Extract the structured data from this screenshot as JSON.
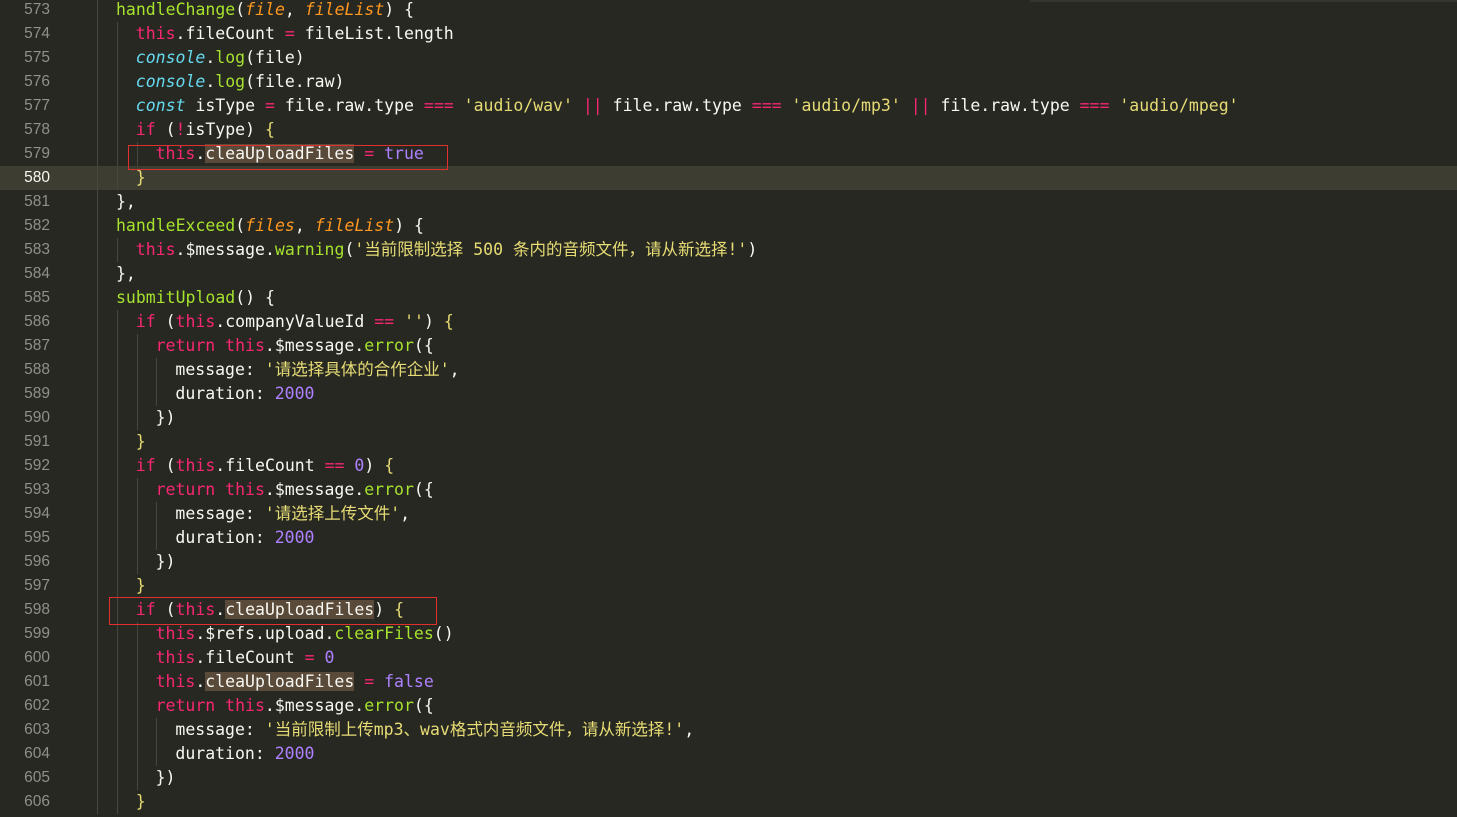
{
  "editor": {
    "active_line": 580,
    "lines": [
      {
        "n": 573,
        "indent": 0,
        "tokens": [
          [
            "fn",
            "handleChange"
          ],
          [
            "punc",
            "("
          ],
          [
            "param",
            "file"
          ],
          [
            "punc",
            ", "
          ],
          [
            "param",
            "fileList"
          ],
          [
            "punc",
            ") {"
          ]
        ]
      },
      {
        "n": 574,
        "indent": 1,
        "tokens": [
          [
            "this",
            "this"
          ],
          [
            "punc",
            "."
          ],
          [
            "prop",
            "fileCount"
          ],
          [
            "op",
            " = "
          ],
          [
            "prop",
            "fileList.length"
          ]
        ]
      },
      {
        "n": 575,
        "indent": 1,
        "tokens": [
          [
            "obj",
            "console"
          ],
          [
            "punc",
            "."
          ],
          [
            "method",
            "log"
          ],
          [
            "punc",
            "(file)"
          ]
        ]
      },
      {
        "n": 576,
        "indent": 1,
        "tokens": [
          [
            "obj",
            "console"
          ],
          [
            "punc",
            "."
          ],
          [
            "method",
            "log"
          ],
          [
            "punc",
            "(file.raw)"
          ]
        ]
      },
      {
        "n": 577,
        "indent": 1,
        "tokens": [
          [
            "decl",
            "const"
          ],
          [
            "plain",
            " isType "
          ],
          [
            "op",
            "="
          ],
          [
            "plain",
            " file.raw.type "
          ],
          [
            "op",
            "==="
          ],
          [
            "plain",
            " "
          ],
          [
            "str",
            "'audio/wav'"
          ],
          [
            "plain",
            " "
          ],
          [
            "op",
            "||"
          ],
          [
            "plain",
            " file.raw.type "
          ],
          [
            "op",
            "==="
          ],
          [
            "plain",
            " "
          ],
          [
            "str",
            "'audio/mp3'"
          ],
          [
            "plain",
            " "
          ],
          [
            "op",
            "||"
          ],
          [
            "plain",
            " file.raw.type "
          ],
          [
            "op",
            "==="
          ],
          [
            "plain",
            " "
          ],
          [
            "str",
            "'audio/mpeg'"
          ]
        ]
      },
      {
        "n": 578,
        "indent": 1,
        "tokens": [
          [
            "kw",
            "if"
          ],
          [
            "plain",
            " ("
          ],
          [
            "op",
            "!"
          ],
          [
            "plain",
            "isType) "
          ],
          [
            "brkgold",
            "{"
          ]
        ]
      },
      {
        "n": 579,
        "indent": 2,
        "tokens": [
          [
            "this",
            "this"
          ],
          [
            "punc",
            "."
          ],
          [
            "hl",
            "cleaUploadFiles"
          ],
          [
            "op",
            " = "
          ],
          [
            "bool",
            "true"
          ]
        ]
      },
      {
        "n": 580,
        "indent": 1,
        "tokens": [
          [
            "brkgold",
            "}"
          ]
        ]
      },
      {
        "n": 581,
        "indent": 0,
        "tokens": [
          [
            "punc",
            "},"
          ]
        ]
      },
      {
        "n": 582,
        "indent": 0,
        "tokens": [
          [
            "fn",
            "handleExceed"
          ],
          [
            "punc",
            "("
          ],
          [
            "param",
            "files"
          ],
          [
            "punc",
            ", "
          ],
          [
            "param",
            "fileList"
          ],
          [
            "punc",
            ") {"
          ]
        ]
      },
      {
        "n": 583,
        "indent": 1,
        "tokens": [
          [
            "this",
            "this"
          ],
          [
            "punc",
            ".$message."
          ],
          [
            "method",
            "warning"
          ],
          [
            "punc",
            "("
          ],
          [
            "str",
            "'当前限制选择 500 条内的音频文件，请从新选择!'"
          ],
          [
            "punc",
            ")"
          ]
        ]
      },
      {
        "n": 584,
        "indent": 0,
        "tokens": [
          [
            "punc",
            "},"
          ]
        ]
      },
      {
        "n": 585,
        "indent": 0,
        "tokens": [
          [
            "fn",
            "submitUpload"
          ],
          [
            "punc",
            "() {"
          ]
        ]
      },
      {
        "n": 586,
        "indent": 1,
        "tokens": [
          [
            "kw",
            "if"
          ],
          [
            "plain",
            " ("
          ],
          [
            "this",
            "this"
          ],
          [
            "plain",
            ".companyValueId "
          ],
          [
            "op",
            "=="
          ],
          [
            "plain",
            " "
          ],
          [
            "str",
            "''"
          ],
          [
            "plain",
            ") "
          ],
          [
            "brkgold",
            "{"
          ]
        ]
      },
      {
        "n": 587,
        "indent": 2,
        "tokens": [
          [
            "kw",
            "return"
          ],
          [
            "plain",
            " "
          ],
          [
            "this",
            "this"
          ],
          [
            "plain",
            ".$message."
          ],
          [
            "method",
            "error"
          ],
          [
            "plain",
            "({"
          ]
        ]
      },
      {
        "n": 588,
        "indent": 3,
        "tokens": [
          [
            "plain",
            "message: "
          ],
          [
            "str",
            "'请选择具体的合作企业'"
          ],
          [
            "plain",
            ","
          ]
        ]
      },
      {
        "n": 589,
        "indent": 3,
        "tokens": [
          [
            "plain",
            "duration: "
          ],
          [
            "num",
            "2000"
          ]
        ]
      },
      {
        "n": 590,
        "indent": 2,
        "tokens": [
          [
            "plain",
            "})"
          ]
        ]
      },
      {
        "n": 591,
        "indent": 1,
        "tokens": [
          [
            "brkgold",
            "}"
          ]
        ]
      },
      {
        "n": 592,
        "indent": 1,
        "tokens": [
          [
            "kw",
            "if"
          ],
          [
            "plain",
            " ("
          ],
          [
            "this",
            "this"
          ],
          [
            "plain",
            ".fileCount "
          ],
          [
            "op",
            "=="
          ],
          [
            "plain",
            " "
          ],
          [
            "num",
            "0"
          ],
          [
            "plain",
            ") "
          ],
          [
            "brkgold",
            "{"
          ]
        ]
      },
      {
        "n": 593,
        "indent": 2,
        "tokens": [
          [
            "kw",
            "return"
          ],
          [
            "plain",
            " "
          ],
          [
            "this",
            "this"
          ],
          [
            "plain",
            ".$message."
          ],
          [
            "method",
            "error"
          ],
          [
            "plain",
            "({"
          ]
        ]
      },
      {
        "n": 594,
        "indent": 3,
        "tokens": [
          [
            "plain",
            "message: "
          ],
          [
            "str",
            "'请选择上传文件'"
          ],
          [
            "plain",
            ","
          ]
        ]
      },
      {
        "n": 595,
        "indent": 3,
        "tokens": [
          [
            "plain",
            "duration: "
          ],
          [
            "num",
            "2000"
          ]
        ]
      },
      {
        "n": 596,
        "indent": 2,
        "tokens": [
          [
            "plain",
            "})"
          ]
        ]
      },
      {
        "n": 597,
        "indent": 1,
        "tokens": [
          [
            "brkgold",
            "}"
          ]
        ]
      },
      {
        "n": 598,
        "indent": 1,
        "tokens": [
          [
            "kw",
            "if"
          ],
          [
            "plain",
            " ("
          ],
          [
            "this",
            "this"
          ],
          [
            "plain",
            "."
          ],
          [
            "hl",
            "cleaUploadFiles"
          ],
          [
            "plain",
            ") "
          ],
          [
            "brkgold",
            "{"
          ]
        ]
      },
      {
        "n": 599,
        "indent": 2,
        "tokens": [
          [
            "this",
            "this"
          ],
          [
            "plain",
            ".$refs.upload."
          ],
          [
            "method",
            "clearFiles"
          ],
          [
            "plain",
            "()"
          ]
        ]
      },
      {
        "n": 600,
        "indent": 2,
        "tokens": [
          [
            "this",
            "this"
          ],
          [
            "plain",
            ".fileCount "
          ],
          [
            "op",
            "="
          ],
          [
            "plain",
            " "
          ],
          [
            "num",
            "0"
          ]
        ]
      },
      {
        "n": 601,
        "indent": 2,
        "tokens": [
          [
            "this",
            "this"
          ],
          [
            "plain",
            "."
          ],
          [
            "hl",
            "cleaUploadFiles"
          ],
          [
            "op",
            " = "
          ],
          [
            "bool",
            "false"
          ]
        ]
      },
      {
        "n": 602,
        "indent": 2,
        "tokens": [
          [
            "kw",
            "return"
          ],
          [
            "plain",
            " "
          ],
          [
            "this",
            "this"
          ],
          [
            "plain",
            ".$message."
          ],
          [
            "method",
            "error"
          ],
          [
            "plain",
            "({"
          ]
        ]
      },
      {
        "n": 603,
        "indent": 3,
        "tokens": [
          [
            "plain",
            "message: "
          ],
          [
            "str",
            "'当前限制上传mp3、wav格式内音频文件，请从新选择!'"
          ],
          [
            "plain",
            ","
          ]
        ]
      },
      {
        "n": 604,
        "indent": 3,
        "tokens": [
          [
            "plain",
            "duration: "
          ],
          [
            "num",
            "2000"
          ]
        ]
      },
      {
        "n": 605,
        "indent": 2,
        "tokens": [
          [
            "plain",
            "})"
          ]
        ]
      },
      {
        "n": 606,
        "indent": 1,
        "tokens": [
          [
            "brkgold",
            "}"
          ]
        ]
      }
    ]
  },
  "colors": {
    "background": "#272822",
    "active_line": "#3e3d32",
    "keyword": "#f92672",
    "function": "#a6e22e",
    "param": "#fd971f",
    "string": "#e6db74",
    "number": "#ae81ff",
    "annotation_box": "#e0302e"
  }
}
